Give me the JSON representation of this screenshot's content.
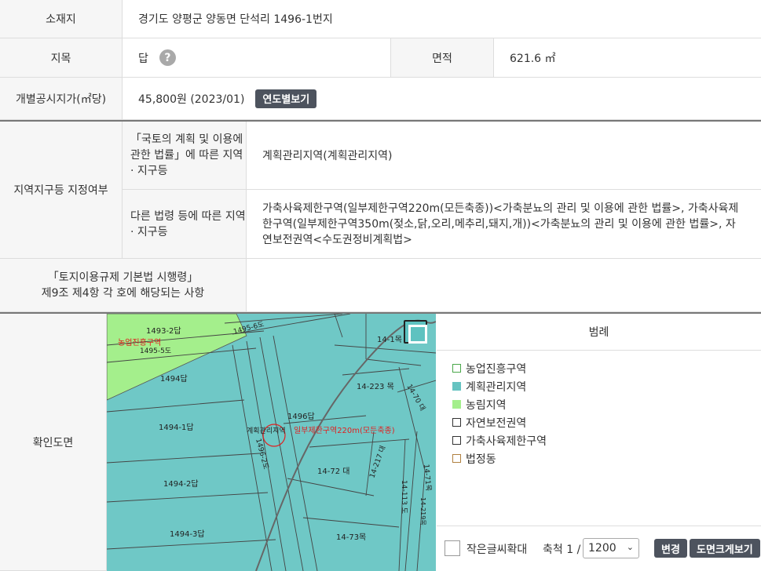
{
  "rows": {
    "location": {
      "label": "소재지",
      "value": "경기도 양평군 양동면 단석리 1496-1번지"
    },
    "land_category": {
      "label": "지목",
      "value": "답",
      "help": "?",
      "area_label": "면적",
      "area_value": "621.6 ㎡"
    },
    "official_price": {
      "label": "개별공시지가(㎡당)",
      "value": "45,800원 (2023/01)",
      "button": "연도별보기"
    },
    "zoning": {
      "label": "지역지구등 지정여부",
      "sub1_label": "「국토의 계획 및 이용에 관한 법률」에 따른 지역 · 지구등",
      "sub1_value": "계획관리지역(계획관리지역)",
      "sub2_label": "다른 법령 등에 따른 지역 · 지구등",
      "sub2_value": "가축사육제한구역(일부제한구역220m(모든축종))<가축분뇨의 관리 및 이용에 관한 법률>, 가축사육제한구역(일부제한구역350m(젖소,닭,오리,메추리,돼지,개))<가축분뇨의 관리 및 이용에 관한 법률>, 자연보전권역<수도권정비계획법>"
    },
    "regulation": {
      "label_line1": "「토지이용규제 기본법 시행령」",
      "label_line2": "제9조 제4항 각 호에 해당되는 사항",
      "value": ""
    },
    "map_row": {
      "label": "확인도면"
    }
  },
  "map": {
    "labels": [
      "1493-2답",
      "1495-6도",
      "농업진흥구역",
      "1495-5도",
      "14-1목",
      "1494답",
      "14-223 목",
      "14-70 대",
      "1496답",
      "1494-1답",
      "계획관리지역",
      "일부제한구역220m(모든축종)",
      "1496-2도",
      "14-217 대",
      "14-72 대",
      "14-71목",
      "1494-2답",
      "14-113 도",
      "14-219목",
      "1494-3답",
      "14-73목"
    ],
    "colors": {
      "teal": "#6fc8c6",
      "green": "#a4ef8c",
      "red_label": "#e02020"
    }
  },
  "legend": {
    "title": "범례",
    "items": [
      {
        "label": "농업진흥구역",
        "fill": "#ffffff",
        "border": "#4aa84a"
      },
      {
        "label": "계획관리지역",
        "fill": "#66c3c1",
        "border": "#66c3c1"
      },
      {
        "label": "농림지역",
        "fill": "#a4ef8c",
        "border": "#a4ef8c"
      },
      {
        "label": "자연보전권역",
        "fill": "#ffffff",
        "border": "#333333"
      },
      {
        "label": "가축사육제한구역",
        "fill": "#ffffff",
        "border": "#333333"
      },
      {
        "label": "법정동",
        "fill": "#ffffff",
        "border": "#b08040"
      }
    ]
  },
  "controls": {
    "large_font_label": "작은글씨확대",
    "scale_label": "축척 1 /",
    "scale_value": "1200",
    "change_button": "변경",
    "zoom_button": "도면크게보기"
  }
}
